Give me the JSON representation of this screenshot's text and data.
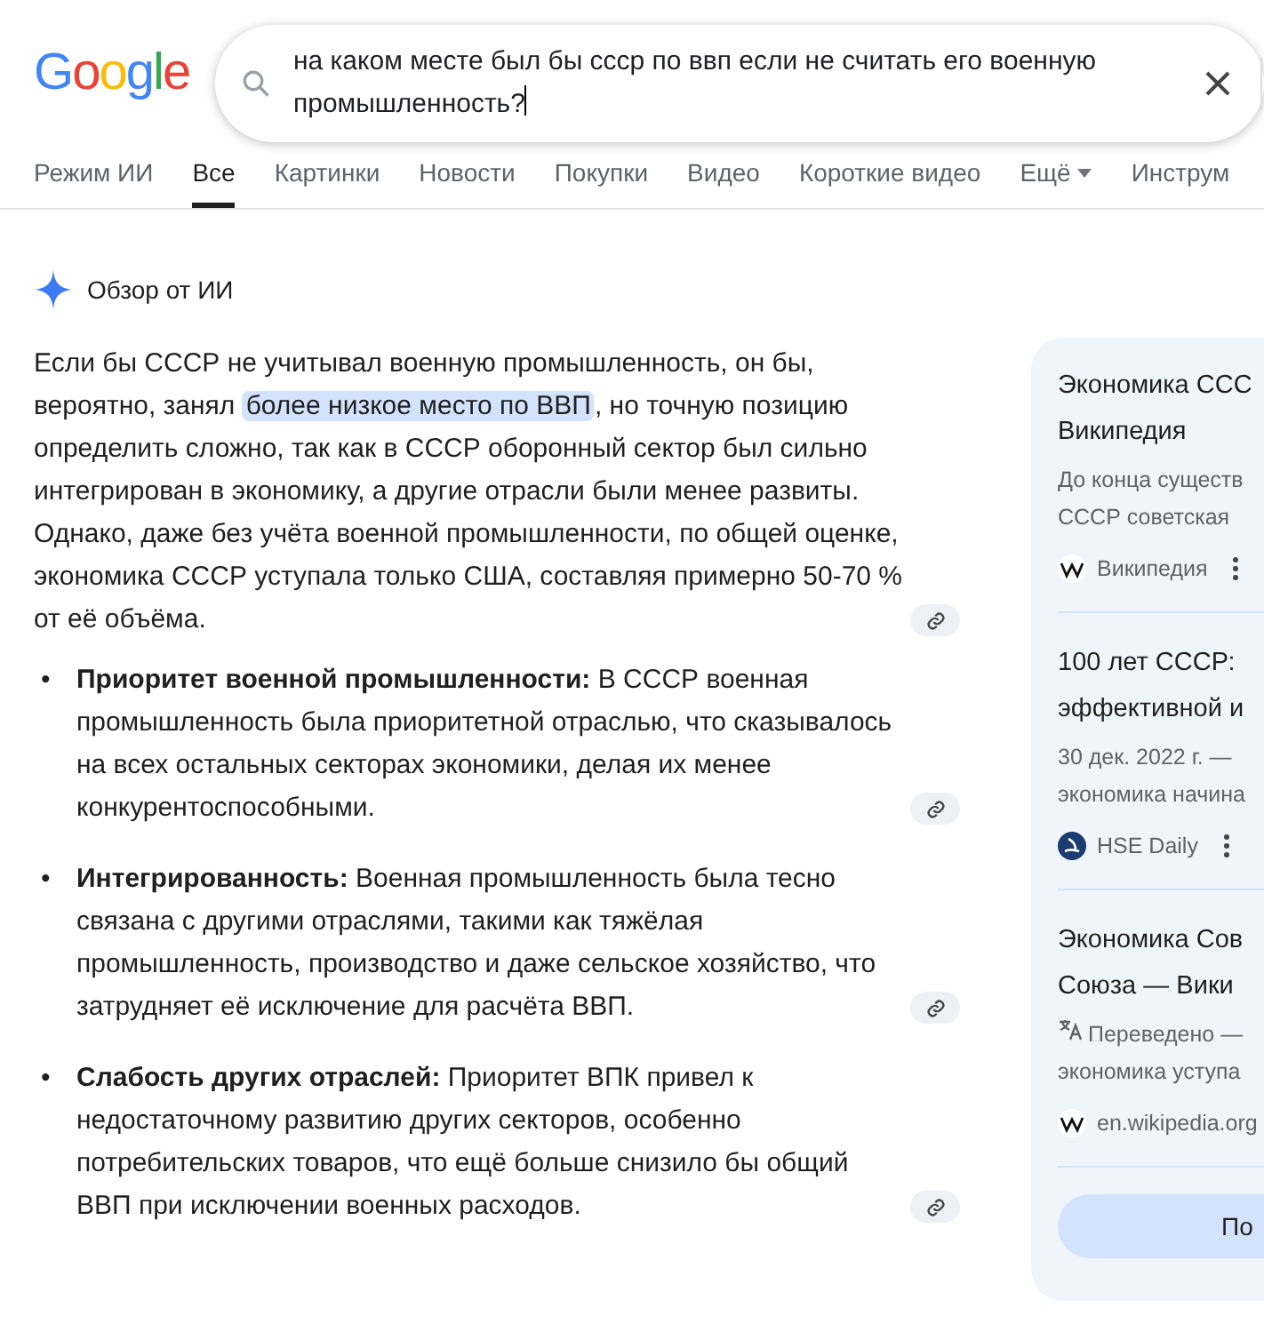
{
  "logo": "Google",
  "search": {
    "value": "на каком месте был бы ссср по ввп если не считать его военную промышленность?"
  },
  "tabs": [
    {
      "label": "Режим ИИ",
      "selected": false,
      "kind": "plain"
    },
    {
      "label": "Все",
      "selected": true,
      "kind": "plain"
    },
    {
      "label": "Картинки",
      "selected": false,
      "kind": "plain"
    },
    {
      "label": "Новости",
      "selected": false,
      "kind": "plain"
    },
    {
      "label": "Покупки",
      "selected": false,
      "kind": "plain"
    },
    {
      "label": "Видео",
      "selected": false,
      "kind": "plain"
    },
    {
      "label": "Короткие видео",
      "selected": false,
      "kind": "plain"
    },
    {
      "label": "Ещё",
      "selected": false,
      "kind": "menu"
    },
    {
      "label": "Инструм",
      "selected": false,
      "kind": "plain"
    }
  ],
  "overview": {
    "title": "Обзор от ИИ",
    "intro": {
      "before": "Если бы СССР не учитывал военную промышленность, он бы, вероятно, занял ",
      "highlight": "более низкое место по ВВП",
      "after": ", но точную позицию определить сложно, так как в СССР оборонный сектор был сильно интегрирован в экономику, а другие отрасли были менее развиты. Однако, даже без учёта военной промышленности, по общей оценке, экономика СССР уступала только США, составляя примерно 50-70 % от её объёма."
    },
    "bullets": [
      {
        "bullet": "•",
        "text": "**Приоритет военной промышленности:** В СССР военная промышленность была приоритетной отраслью, что сказывалось на всех остальных секторах экономики, делая их менее конкурентоспособными."
      },
      {
        "bullet": "•",
        "text": "**Интегрированность:** Военная промышленность была тесно связана с другими отраслями, такими как тяжёлая промышленность, производство и даже сельское хозяйство, что затрудняет её исключение для расчёта ВВП."
      },
      {
        "bullet": "•",
        "text": "**Слабость других отраслей:** Приоритет ВПК привел к недостаточному развитию других секторов, особенно потребительских товаров, что ещё больше снизило бы общий ВВП при исключении военных расходов."
      }
    ]
  },
  "sources": [
    {
      "title_lines": [
        "Экономика ССС",
        "Википедия"
      ],
      "snippet_lines": [
        "До конца существ",
        "СССР советская"
      ],
      "translated": false,
      "site": "Википедия",
      "kind": "wikipedia",
      "menu": true
    },
    {
      "title_lines": [
        "100 лет СССР:",
        "эффективной и"
      ],
      "snippet_lines": [
        "30 дек. 2022 г. —",
        "экономика начина"
      ],
      "translated": false,
      "site": "HSE Daily",
      "kind": "hse",
      "menu": true
    },
    {
      "title_lines": [
        "Экономика Сов",
        "Союза — Вики"
      ],
      "snippet_lines": [
        "Переведено —",
        "экономика уступа"
      ],
      "translated": true,
      "site": "en.wikipedia.org",
      "kind": "wikipedia",
      "menu": false
    }
  ],
  "show_all_button": "По"
}
